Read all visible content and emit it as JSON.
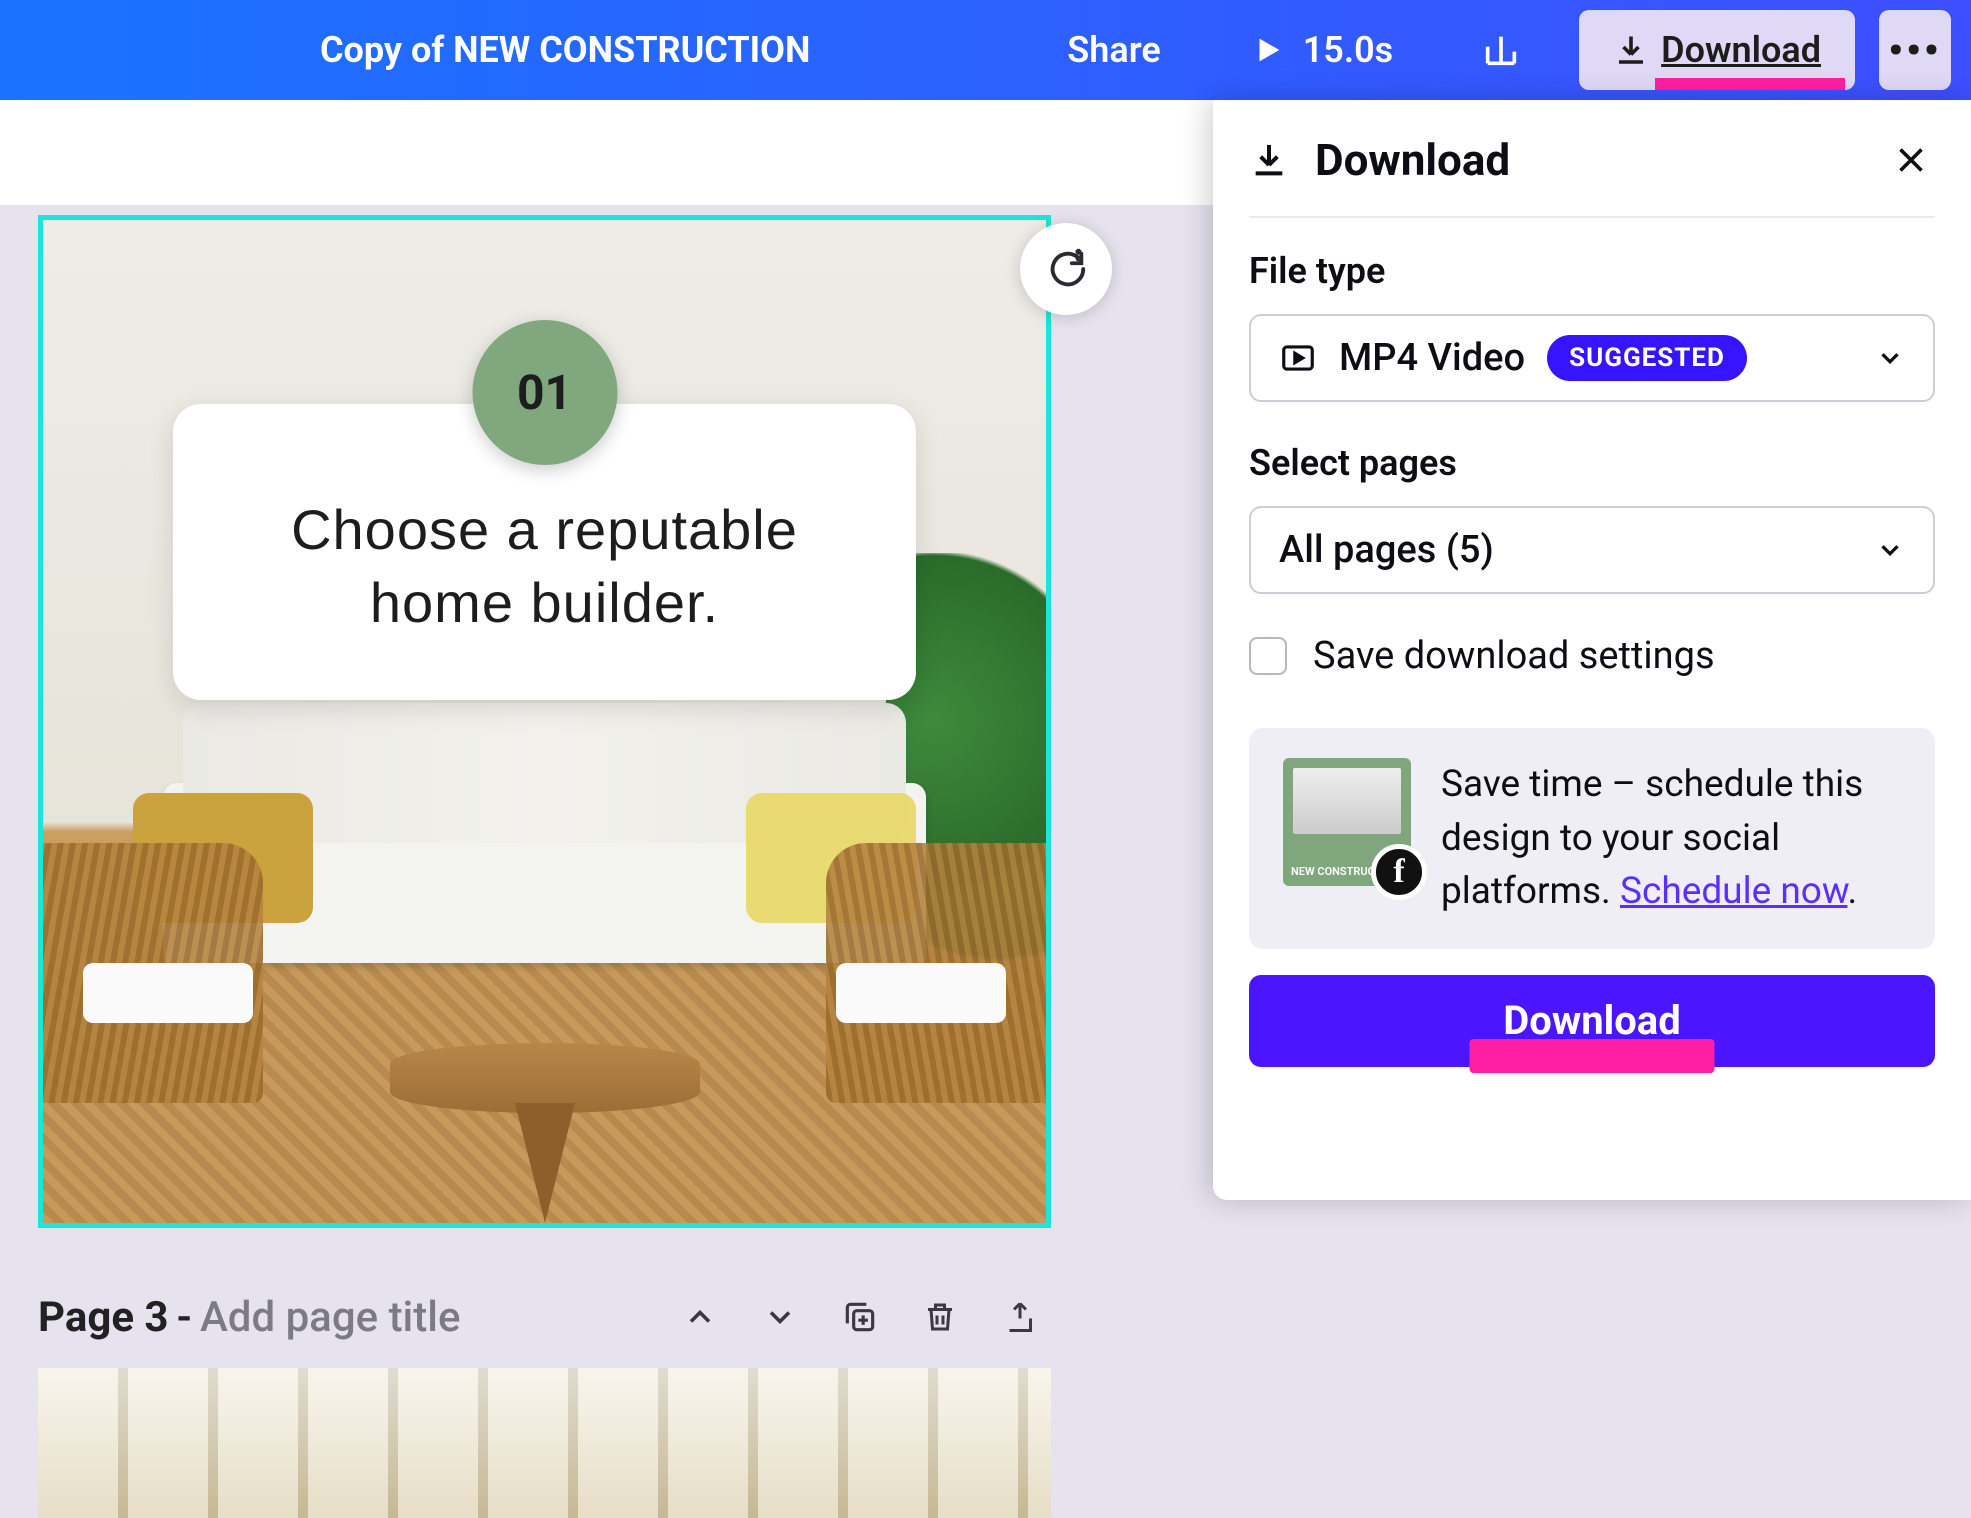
{
  "header": {
    "doc_title": "Copy of NEW CONSTRUCTION",
    "share_label": "Share",
    "duration": "15.0s",
    "download_label": "Download"
  },
  "canvas": {
    "badge_number": "01",
    "card_text": "Choose a reputable home builder."
  },
  "page_controls": {
    "page_label": "Page 3",
    "separator": "-",
    "title_placeholder": "Add page title"
  },
  "download_panel": {
    "title": "Download",
    "file_type_label": "File type",
    "file_type_value": "MP4 Video",
    "suggested_badge": "SUGGESTED",
    "select_pages_label": "Select pages",
    "select_pages_value": "All pages (5)",
    "save_settings_label": "Save download settings",
    "promo_text": "Save time – schedule this design to your social platforms. ",
    "promo_link": "Schedule now",
    "promo_period": ".",
    "promo_thumb_label": "NEW CONSTRUCTI",
    "download_button": "Download"
  }
}
